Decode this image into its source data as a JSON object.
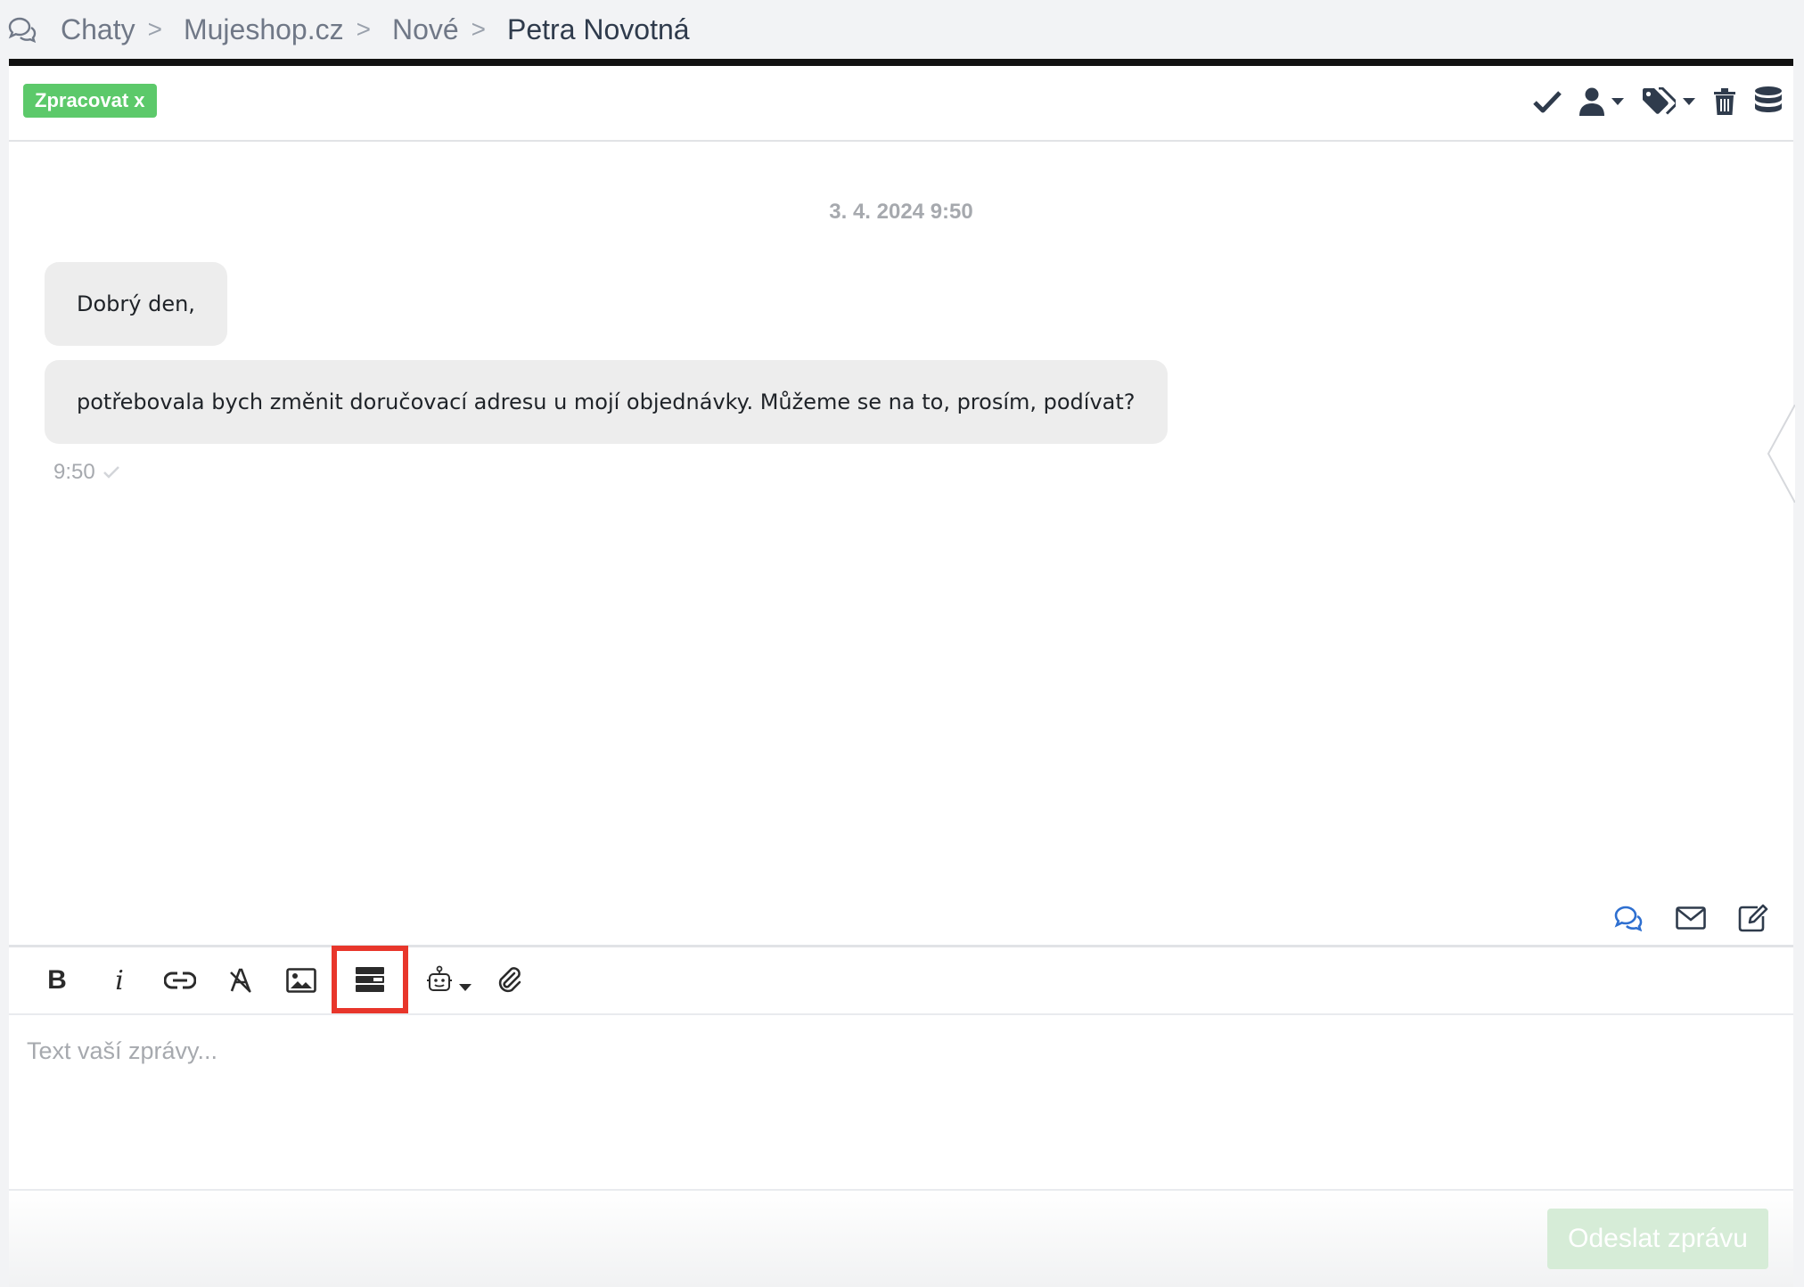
{
  "breadcrumb": {
    "icon": "chat-bubbles-icon",
    "items": [
      "Chaty",
      "Mujeshop.cz",
      "Nové",
      "Petra Novotná"
    ],
    "separator": ">"
  },
  "header": {
    "badge": "Zpracovat x",
    "badge_color": "#5cc96a",
    "actions": [
      "check-icon",
      "user-icon",
      "tags-icon",
      "trash-icon",
      "database-icon"
    ]
  },
  "conversation": {
    "date": "3. 4. 2024 9:50",
    "messages": [
      {
        "text": "Dobrý den,"
      },
      {
        "text": "potřebovala bych změnit doručovací adresu u mojí objednávky. Můžeme se na to, prosím, podívat?"
      }
    ],
    "time": "9:50"
  },
  "channels": [
    "chat-icon",
    "email-icon",
    "note-edit-icon"
  ],
  "toolbar": {
    "buttons": [
      "bold-icon",
      "italic-icon",
      "link-icon",
      "clear-format-icon",
      "image-icon",
      "template-icon",
      "bot-icon",
      "attachment-icon"
    ],
    "bold_label": "B",
    "italic_label": "i",
    "highlight_color": "#e8362b"
  },
  "editor": {
    "placeholder": "Text vaší zprávy..."
  },
  "footer": {
    "send_label": "Odeslat zprávu"
  },
  "colors": {
    "accent_blue": "#2e6fd0",
    "icon_dark": "#2f3b4c"
  }
}
